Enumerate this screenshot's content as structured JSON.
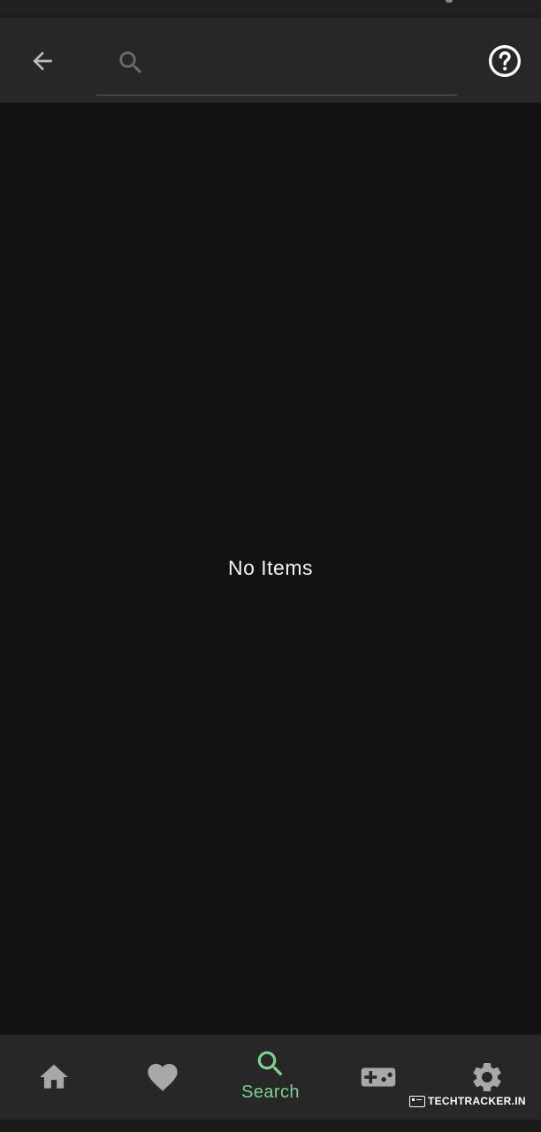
{
  "colors": {
    "background": "#121212",
    "app_bar": "#272727",
    "icon": "#a8a8a8",
    "active": "#7fd18f",
    "text": "#f2f2f2"
  },
  "header": {
    "back_icon": "arrow-back-icon",
    "search": {
      "icon": "search-icon",
      "value": "",
      "placeholder": ""
    },
    "help_icon": "help-circle-icon"
  },
  "main": {
    "empty_message": "No Items"
  },
  "bottom_nav": {
    "items": [
      {
        "id": "home",
        "icon": "home-icon",
        "label": "",
        "active": false
      },
      {
        "id": "favorites",
        "icon": "heart-icon",
        "label": "",
        "active": false
      },
      {
        "id": "search",
        "icon": "search-icon",
        "label": "Search",
        "active": true
      },
      {
        "id": "games",
        "icon": "gamepad-icon",
        "label": "",
        "active": false
      },
      {
        "id": "settings",
        "icon": "gear-icon",
        "label": "",
        "active": false
      }
    ]
  },
  "watermark": {
    "text": "TechTracker.in",
    "display": "TECHTRACKER.IN"
  }
}
